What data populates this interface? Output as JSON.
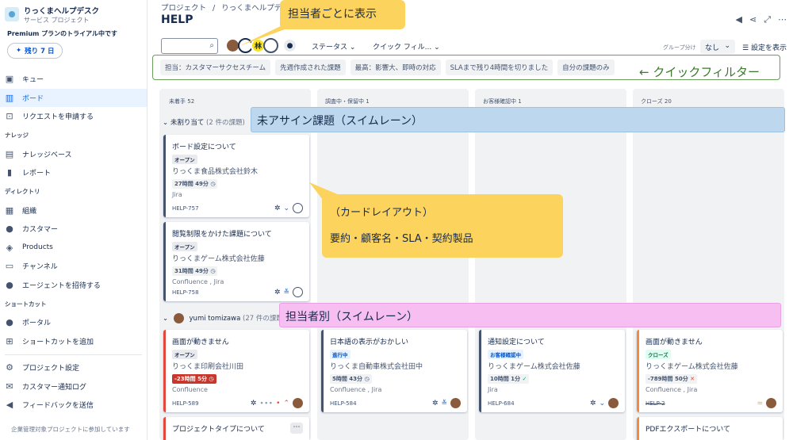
{
  "sidebar": {
    "project_name": "りっくまヘルプデスク",
    "project_type": "サービス プロジェクト",
    "trial_text": "Premium プランのトライアル中です",
    "trial_button": "残り 7 日",
    "items_main": [
      {
        "label": "キュー",
        "icon": "queue-icon",
        "glyph": "▣"
      },
      {
        "label": "ボード",
        "icon": "board-icon",
        "glyph": "▥",
        "active": true
      },
      {
        "label": "リクエストを申請する",
        "icon": "request-icon",
        "glyph": "⊡"
      }
    ],
    "section_knowledge": "ナレッジ",
    "items_knowledge": [
      {
        "label": "ナレッジベース",
        "icon": "book-icon",
        "glyph": "▤"
      },
      {
        "label": "レポート",
        "icon": "report-icon",
        "glyph": "▮"
      }
    ],
    "section_directory": "ディレクトリ",
    "items_directory": [
      {
        "label": "組織",
        "icon": "organization-icon",
        "glyph": "▦"
      },
      {
        "label": "カスタマー",
        "icon": "customers-icon",
        "glyph": "●"
      },
      {
        "label": "Products",
        "icon": "products-icon",
        "glyph": "◈"
      },
      {
        "label": "チャンネル",
        "icon": "channel-icon",
        "glyph": "▭"
      },
      {
        "label": "エージェントを招待する",
        "icon": "invite-agent-icon",
        "glyph": "●"
      }
    ],
    "section_shortcut": "ショートカット",
    "items_shortcut": [
      {
        "label": "ポータル",
        "icon": "cherry-icon",
        "glyph": "●"
      },
      {
        "label": "ショートカットを追加",
        "icon": "add-shortcut-icon",
        "glyph": "⊞"
      }
    ],
    "items_bottom": [
      {
        "label": "プロジェクト設定",
        "icon": "gear-icon",
        "glyph": "⚙"
      },
      {
        "label": "カスタマー通知ログ",
        "icon": "mail-icon",
        "glyph": "✉"
      },
      {
        "label": "フィードバックを送信",
        "icon": "megaphone-icon",
        "glyph": "◀"
      }
    ],
    "footer": "企業管理対象プロジェクトに参加しています"
  },
  "header": {
    "breadcrumb_1": "プロジェクト",
    "breadcrumb_sep": "/",
    "breadcrumb_2": "りっくまヘルプデスク",
    "title": "HELP"
  },
  "toolbar": {
    "avatar_kanji": "林",
    "status_filter": "ステータス",
    "quick_filter": "クイック フィル...",
    "group_label": "グループ分け",
    "group_value": "なし",
    "settings": "設定を表示"
  },
  "quick_filters": [
    "担当：カスタマーサクセスチーム",
    "先週作成された課題",
    "最高：影響大、即時の対応",
    "SLAまで残り4時間を切りました",
    "自分の課題のみ"
  ],
  "columns": [
    {
      "name": "未着手",
      "count": "52"
    },
    {
      "name": "調査中・保留中",
      "count": "1"
    },
    {
      "name": "お客様確認中",
      "count": "1"
    },
    {
      "name": "クローズ",
      "count": "20"
    }
  ],
  "swimlanes": [
    {
      "name": "未割り当て",
      "count": "(2 件の課題)"
    },
    {
      "name": "yumi tomizawa",
      "count": "(27 件の課題)"
    }
  ],
  "cards": [
    {
      "title": "ボード設定について",
      "status": "オープン",
      "customer": "りっくま食品株式会社鈴木",
      "sla": "27時間 49分",
      "product": "Jira",
      "key": "HELP-757"
    },
    {
      "title": "閲覧制限をかけた課題について",
      "status": "オープン",
      "customer": "りっくまゲーム株式会社佐藤",
      "sla": "31時間 49分",
      "product": "Confluence , Jira",
      "key": "HELP-758"
    },
    {
      "title": "画面が動きません",
      "status": "オープン",
      "customer": "りっくま印刷会社川田",
      "sla": "-23時間 5分",
      "product": "Confluence",
      "key": "HELP-589"
    },
    {
      "title": "日本語の表示がおかしい",
      "status": "進行中",
      "customer": "りっくま自動車株式会社田中",
      "sla": "5時間 43分",
      "product": "Confluence , Jira",
      "key": "HELP-584"
    },
    {
      "title": "通知設定について",
      "status": "お客様確認中",
      "customer": "りっくまゲーム株式会社佐藤",
      "sla": "10時間 1分",
      "product": "Jira",
      "key": "HELP-684"
    },
    {
      "title": "画面が動きません",
      "status": "クローズ",
      "customer": "りっくまゲーム株式会社佐藤",
      "sla": "-789時間 50分",
      "product": "Confluence , Jira",
      "key": "HELP-2"
    },
    {
      "title": "プロジェクトタイプについて"
    },
    {
      "title": "PDFエクスポートについて"
    }
  ],
  "annotations": {
    "assignee": "担当者ごとに表示",
    "quickfilter": "← クイックフィルター",
    "unassigned": "未アサイン課題（スイムレーン）",
    "card_title": "（カードレイアウト）",
    "card_desc": "要約・顧客名・SLA・契約製品",
    "by_assignee": "担当者別（スイムレーン）"
  }
}
